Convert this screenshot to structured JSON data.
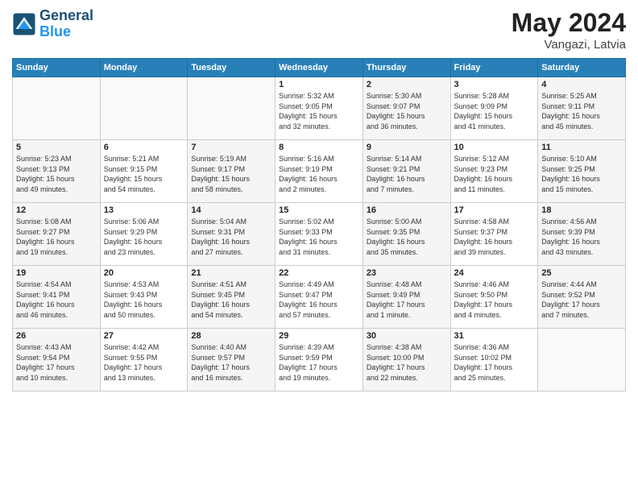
{
  "header": {
    "logo_line1": "General",
    "logo_line2": "Blue",
    "month": "May 2024",
    "location": "Vangazi, Latvia"
  },
  "weekdays": [
    "Sunday",
    "Monday",
    "Tuesday",
    "Wednesday",
    "Thursday",
    "Friday",
    "Saturday"
  ],
  "weeks": [
    [
      {
        "num": "",
        "info": ""
      },
      {
        "num": "",
        "info": ""
      },
      {
        "num": "",
        "info": ""
      },
      {
        "num": "1",
        "info": "Sunrise: 5:32 AM\nSunset: 9:05 PM\nDaylight: 15 hours\nand 32 minutes."
      },
      {
        "num": "2",
        "info": "Sunrise: 5:30 AM\nSunset: 9:07 PM\nDaylight: 15 hours\nand 36 minutes."
      },
      {
        "num": "3",
        "info": "Sunrise: 5:28 AM\nSunset: 9:09 PM\nDaylight: 15 hours\nand 41 minutes."
      },
      {
        "num": "4",
        "info": "Sunrise: 5:25 AM\nSunset: 9:11 PM\nDaylight: 15 hours\nand 45 minutes."
      }
    ],
    [
      {
        "num": "5",
        "info": "Sunrise: 5:23 AM\nSunset: 9:13 PM\nDaylight: 15 hours\nand 49 minutes."
      },
      {
        "num": "6",
        "info": "Sunrise: 5:21 AM\nSunset: 9:15 PM\nDaylight: 15 hours\nand 54 minutes."
      },
      {
        "num": "7",
        "info": "Sunrise: 5:19 AM\nSunset: 9:17 PM\nDaylight: 15 hours\nand 58 minutes."
      },
      {
        "num": "8",
        "info": "Sunrise: 5:16 AM\nSunset: 9:19 PM\nDaylight: 16 hours\nand 2 minutes."
      },
      {
        "num": "9",
        "info": "Sunrise: 5:14 AM\nSunset: 9:21 PM\nDaylight: 16 hours\nand 7 minutes."
      },
      {
        "num": "10",
        "info": "Sunrise: 5:12 AM\nSunset: 9:23 PM\nDaylight: 16 hours\nand 11 minutes."
      },
      {
        "num": "11",
        "info": "Sunrise: 5:10 AM\nSunset: 9:25 PM\nDaylight: 16 hours\nand 15 minutes."
      }
    ],
    [
      {
        "num": "12",
        "info": "Sunrise: 5:08 AM\nSunset: 9:27 PM\nDaylight: 16 hours\nand 19 minutes."
      },
      {
        "num": "13",
        "info": "Sunrise: 5:06 AM\nSunset: 9:29 PM\nDaylight: 16 hours\nand 23 minutes."
      },
      {
        "num": "14",
        "info": "Sunrise: 5:04 AM\nSunset: 9:31 PM\nDaylight: 16 hours\nand 27 minutes."
      },
      {
        "num": "15",
        "info": "Sunrise: 5:02 AM\nSunset: 9:33 PM\nDaylight: 16 hours\nand 31 minutes."
      },
      {
        "num": "16",
        "info": "Sunrise: 5:00 AM\nSunset: 9:35 PM\nDaylight: 16 hours\nand 35 minutes."
      },
      {
        "num": "17",
        "info": "Sunrise: 4:58 AM\nSunset: 9:37 PM\nDaylight: 16 hours\nand 39 minutes."
      },
      {
        "num": "18",
        "info": "Sunrise: 4:56 AM\nSunset: 9:39 PM\nDaylight: 16 hours\nand 43 minutes."
      }
    ],
    [
      {
        "num": "19",
        "info": "Sunrise: 4:54 AM\nSunset: 9:41 PM\nDaylight: 16 hours\nand 46 minutes."
      },
      {
        "num": "20",
        "info": "Sunrise: 4:53 AM\nSunset: 9:43 PM\nDaylight: 16 hours\nand 50 minutes."
      },
      {
        "num": "21",
        "info": "Sunrise: 4:51 AM\nSunset: 9:45 PM\nDaylight: 16 hours\nand 54 minutes."
      },
      {
        "num": "22",
        "info": "Sunrise: 4:49 AM\nSunset: 9:47 PM\nDaylight: 16 hours\nand 57 minutes."
      },
      {
        "num": "23",
        "info": "Sunrise: 4:48 AM\nSunset: 9:49 PM\nDaylight: 17 hours\nand 1 minute."
      },
      {
        "num": "24",
        "info": "Sunrise: 4:46 AM\nSunset: 9:50 PM\nDaylight: 17 hours\nand 4 minutes."
      },
      {
        "num": "25",
        "info": "Sunrise: 4:44 AM\nSunset: 9:52 PM\nDaylight: 17 hours\nand 7 minutes."
      }
    ],
    [
      {
        "num": "26",
        "info": "Sunrise: 4:43 AM\nSunset: 9:54 PM\nDaylight: 17 hours\nand 10 minutes."
      },
      {
        "num": "27",
        "info": "Sunrise: 4:42 AM\nSunset: 9:55 PM\nDaylight: 17 hours\nand 13 minutes."
      },
      {
        "num": "28",
        "info": "Sunrise: 4:40 AM\nSunset: 9:57 PM\nDaylight: 17 hours\nand 16 minutes."
      },
      {
        "num": "29",
        "info": "Sunrise: 4:39 AM\nSunset: 9:59 PM\nDaylight: 17 hours\nand 19 minutes."
      },
      {
        "num": "30",
        "info": "Sunrise: 4:38 AM\nSunset: 10:00 PM\nDaylight: 17 hours\nand 22 minutes."
      },
      {
        "num": "31",
        "info": "Sunrise: 4:36 AM\nSunset: 10:02 PM\nDaylight: 17 hours\nand 25 minutes."
      },
      {
        "num": "",
        "info": ""
      }
    ]
  ]
}
